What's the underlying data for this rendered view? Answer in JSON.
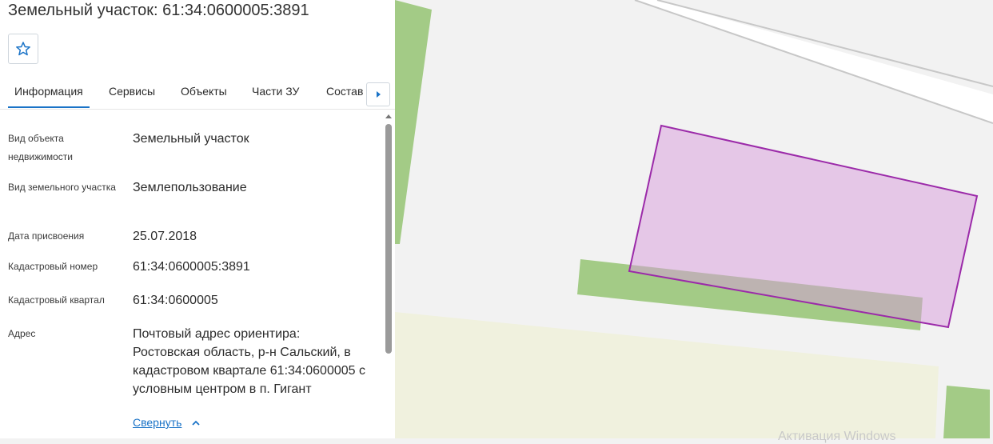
{
  "header": {
    "title": "Земельный участок: 61:34:0600005:3891"
  },
  "tabs": [
    {
      "label": "Информация",
      "active": true
    },
    {
      "label": "Сервисы"
    },
    {
      "label": "Объекты"
    },
    {
      "label": "Части ЗУ"
    },
    {
      "label": "Состав"
    }
  ],
  "info": [
    {
      "label": "Вид объекта недвижимости",
      "value": "Земельный участок"
    },
    {
      "label": "Вид земельного участка",
      "value": "Землепользование"
    },
    {
      "label": "Дата присвоения",
      "value": "25.07.2018"
    },
    {
      "label": "Кадастровый номер",
      "value": "61:34:0600005:3891"
    },
    {
      "label": "Кадастровый квартал",
      "value": "61:34:0600005"
    },
    {
      "label": "Адрес",
      "value": "Почтовый адрес ориентира: Ростовская область, р-н Сальский, в кадастровом квартале 61:34:0600005 с условным центром в п. Гигант"
    }
  ],
  "collapse_label": "Свернуть",
  "watermark": "Активация Windows",
  "colors": {
    "accent": "#1a73c7",
    "parcel_fill": "#e6c8e8",
    "parcel_stroke": "#9b2aa9",
    "green": "#a3cb86",
    "field": "#f0f1de"
  },
  "icons": [
    "star-icon",
    "chevron-right-icon",
    "chevron-up-icon",
    "scroll-up-icon"
  ]
}
